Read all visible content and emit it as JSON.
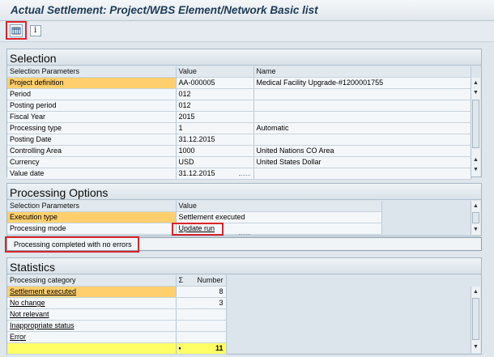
{
  "window": {
    "title": "Actual Settlement: Project/WBS Element/Network Basic list"
  },
  "toolbar": {
    "buttons": [
      {
        "icon": "grid-icon",
        "highlighted": true
      },
      {
        "icon": "info-icon",
        "label": "i"
      }
    ]
  },
  "selection": {
    "title": "Selection",
    "headers": [
      "Selection Parameters",
      "Value",
      "Name"
    ],
    "rows": [
      {
        "param": "Project definition",
        "value": "AA-000005",
        "name": "Medical Facility Upgrade-#1200001755",
        "highlighted": true
      },
      {
        "param": "Period",
        "value": "012",
        "name": ""
      },
      {
        "param": "Posting period",
        "value": "012",
        "name": ""
      },
      {
        "param": "Fiscal Year",
        "value": "2015",
        "name": ""
      },
      {
        "param": "Processing type",
        "value": "1",
        "name": "Automatic"
      },
      {
        "param": "Posting Date",
        "value": "31.12.2015",
        "name": ""
      },
      {
        "param": "Controlling Area",
        "value": "1000",
        "name": "United Nations CO Area"
      },
      {
        "param": "Currency",
        "value": "USD",
        "name": "United States Dollar"
      },
      {
        "param": "Value date",
        "value": "31.12.2015",
        "name": ""
      }
    ]
  },
  "processing_options": {
    "title": "Processing Options",
    "headers": [
      "Selection Parameters",
      "Value"
    ],
    "rows": [
      {
        "param": "Execution type",
        "value": "Settlement executed",
        "highlighted": true
      },
      {
        "param": "Processing mode",
        "value": "Update run",
        "link": true
      }
    ]
  },
  "message": {
    "text": "Processing completed with no errors"
  },
  "statistics": {
    "title": "Statistics",
    "headers": [
      "Processing category",
      "Σ",
      "Number"
    ],
    "rows": [
      {
        "category": "Settlement executed",
        "number": "8",
        "highlighted": true
      },
      {
        "category": "No change",
        "number": "3"
      },
      {
        "category": "Not relevant",
        "number": ""
      },
      {
        "category": "Inappropriate status",
        "number": ""
      },
      {
        "category": "Error",
        "number": ""
      }
    ],
    "total": {
      "marker": "•",
      "number": "11"
    }
  },
  "colors": {
    "highlight_row": "#ffcf6d",
    "total_row": "#ffff66",
    "annotation_red": "#d8262c",
    "title_text": "#1d3a57"
  }
}
